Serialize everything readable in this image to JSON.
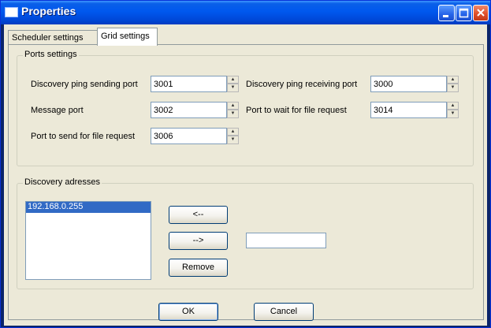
{
  "window": {
    "title": "Properties"
  },
  "tabs": [
    {
      "label": "Scheduler settings"
    },
    {
      "label": "Grid settings"
    }
  ],
  "ports": {
    "group_title": "Ports settings",
    "discovery_send": {
      "label": "Discovery ping sending port",
      "value": "3001"
    },
    "discovery_recv": {
      "label": "Discovery ping receiving port",
      "value": "3000"
    },
    "message": {
      "label": "Message port",
      "value": "3002"
    },
    "wait_file": {
      "label": "Port to wait for file request",
      "value": "3014"
    },
    "send_file": {
      "label": "Port to send for file request",
      "value": "3006"
    }
  },
  "discovery": {
    "group_title": "Discovery adresses",
    "items": [
      "192.168.0.255"
    ],
    "btn_left": "<--",
    "btn_right": "-->",
    "btn_remove": "Remove",
    "address_value": ""
  },
  "buttons": {
    "ok": "OK",
    "cancel": "Cancel"
  },
  "colors": {
    "titlebar": "#0058ee",
    "selection": "#316ac5",
    "face": "#ece9d8",
    "close": "#e0502a"
  },
  "icons": [
    "window-icon",
    "minimize-icon",
    "maximize-icon",
    "close-icon",
    "spin-up-icon",
    "spin-down-icon"
  ]
}
